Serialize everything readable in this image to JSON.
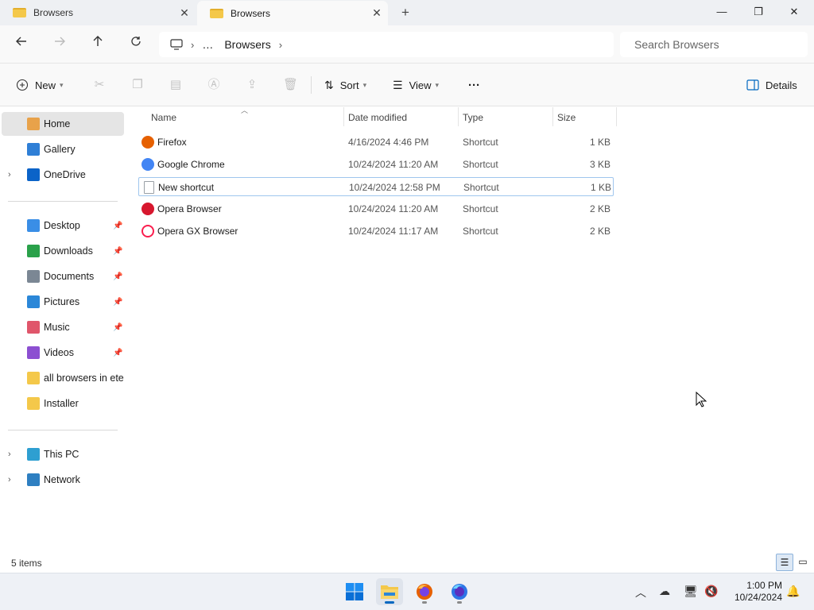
{
  "tabs": [
    {
      "label": "Browsers",
      "active": false
    },
    {
      "label": "Browsers",
      "active": true
    }
  ],
  "window_controls": {
    "minimize": "—",
    "maximize": "❐",
    "close": "✕"
  },
  "nav": {
    "breadcrumb": [
      "…",
      "Browsers"
    ],
    "search_placeholder": "Search Browsers"
  },
  "commands": {
    "new_label": "New",
    "sort_label": "Sort",
    "view_label": "View",
    "more_label": "···",
    "details_label": "Details"
  },
  "sidebar": {
    "items": [
      {
        "label": "Home",
        "icon": "home-icon",
        "color": "#e8a24a",
        "selected": true
      },
      {
        "label": "Gallery",
        "icon": "gallery-icon",
        "color": "#2f7fd6"
      },
      {
        "label": "OneDrive",
        "icon": "cloud-icon",
        "color": "#0b63c8",
        "expandable": true
      },
      {
        "label": "Desktop",
        "icon": "desktop-icon",
        "color": "#3a8ee6",
        "pinned": true
      },
      {
        "label": "Downloads",
        "icon": "download-icon",
        "color": "#2aa14a",
        "pinned": true
      },
      {
        "label": "Documents",
        "icon": "document-icon",
        "color": "#7b8794",
        "pinned": true
      },
      {
        "label": "Pictures",
        "icon": "picture-icon",
        "color": "#2b87d8",
        "pinned": true
      },
      {
        "label": "Music",
        "icon": "music-icon",
        "color": "#e0566b",
        "pinned": true
      },
      {
        "label": "Videos",
        "icon": "video-icon",
        "color": "#8c4fd1",
        "pinned": true
      },
      {
        "label": "all browsers in eternity",
        "icon": "folder-icon",
        "color": "#f4c84a"
      },
      {
        "label": "Installer",
        "icon": "folder-icon",
        "color": "#f4c84a"
      },
      {
        "label": "This PC",
        "icon": "pc-icon",
        "color": "#2e9fd1",
        "expandable": true
      },
      {
        "label": "Network",
        "icon": "network-icon",
        "color": "#2e7fc1",
        "expandable": true
      }
    ]
  },
  "columns": [
    "Name",
    "Date modified",
    "Type",
    "Size"
  ],
  "files": [
    {
      "name": "Firefox",
      "date": "4/16/2024 4:46 PM",
      "type": "Shortcut",
      "size": "1 KB",
      "icon": "firefox-icon",
      "color": "#e66000"
    },
    {
      "name": "Google Chrome",
      "date": "10/24/2024 11:20 AM",
      "type": "Shortcut",
      "size": "3 KB",
      "icon": "chrome-icon",
      "color": "#4285f4"
    },
    {
      "name": "New shortcut",
      "date": "10/24/2024 12:58 PM",
      "type": "Shortcut",
      "size": "1 KB",
      "icon": "shortcut-file-icon",
      "color": "#ffffff"
    },
    {
      "name": "Opera Browser",
      "date": "10/24/2024 11:20 AM",
      "type": "Shortcut",
      "size": "2 KB",
      "icon": "opera-icon",
      "color": "#d7172e"
    },
    {
      "name": "Opera GX Browser",
      "date": "10/24/2024 11:17 AM",
      "type": "Shortcut",
      "size": "2 KB",
      "icon": "opera-gx-icon",
      "color": "#fa1e4e"
    }
  ],
  "status": {
    "item_count": "5 items"
  },
  "clock": {
    "time": "1:00 PM",
    "date": "10/24/2024"
  }
}
